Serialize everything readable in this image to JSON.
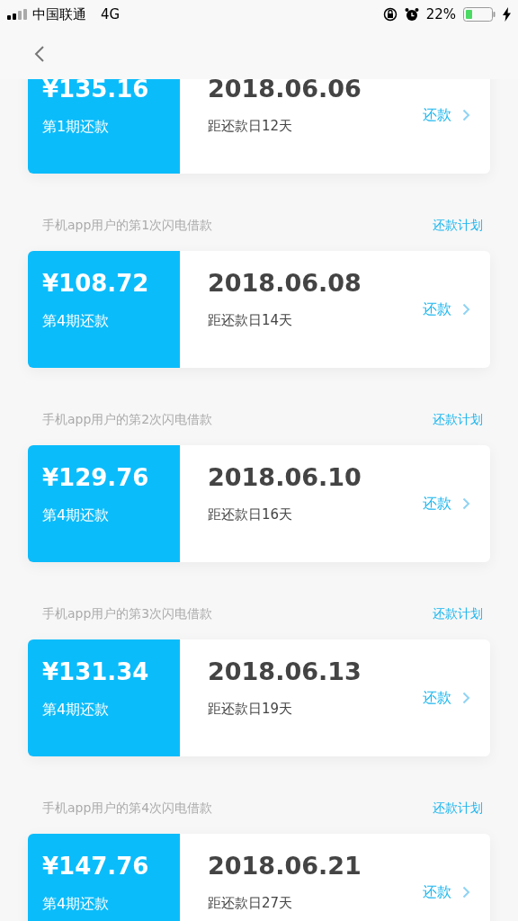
{
  "status_bar": {
    "carrier": "中国联通",
    "network": "4G",
    "battery": "22%"
  },
  "loans": [
    {
      "amount": "¥135.16",
      "period": "第1期还款",
      "date": "2018.06.06",
      "countdown": "距还款日12天",
      "action": "还款"
    },
    {
      "title": "手机app用户的第1次闪电借款",
      "plan": "还款计划",
      "amount": "¥108.72",
      "period": "第4期还款",
      "date": "2018.06.08",
      "countdown": "距还款日14天",
      "action": "还款"
    },
    {
      "title": "手机app用户的第2次闪电借款",
      "plan": "还款计划",
      "amount": "¥129.76",
      "period": "第4期还款",
      "date": "2018.06.10",
      "countdown": "距还款日16天",
      "action": "还款"
    },
    {
      "title": "手机app用户的第3次闪电借款",
      "plan": "还款计划",
      "amount": "¥131.34",
      "period": "第4期还款",
      "date": "2018.06.13",
      "countdown": "距还款日19天",
      "action": "还款"
    },
    {
      "title": "手机app用户的第4次闪电借款",
      "plan": "还款计划",
      "amount": "¥147.76",
      "period": "第4期还款",
      "date": "2018.06.21",
      "countdown": "距还款日27天",
      "action": "还款"
    }
  ]
}
